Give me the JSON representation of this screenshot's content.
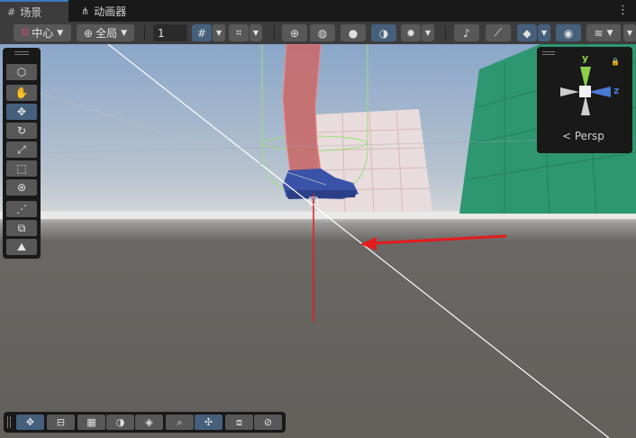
{
  "tabs": [
    {
      "label": "场景",
      "icon": "grid-icon",
      "active": true
    },
    {
      "label": "动画器",
      "icon": "branch-icon",
      "active": false
    }
  ],
  "more_menu_glyph": "⋮",
  "toolbar": {
    "pivot_label": "中心",
    "space_label": "全局",
    "grid_size_value": "1"
  },
  "gizmo": {
    "y_label": "y",
    "z_label": "z",
    "lock_glyph": "🔒",
    "persp_label": "< Persp"
  },
  "colors": {
    "accent_blue": "#46607c",
    "axis_y": "#8ad04a",
    "axis_z": "#4a78d6",
    "annotation_arrow": "#e51c1c",
    "ground_plane": "#2e9670"
  }
}
